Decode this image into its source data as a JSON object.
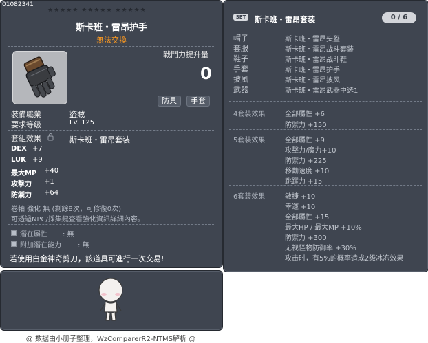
{
  "item": {
    "id": "01082341",
    "stars": "★★★★★   ★★★★★   ★★★★★",
    "name": "斯卡班・雷昂护手",
    "untradeable": "無法交換",
    "icon": "gauntlet-icon",
    "power_label": "戰鬥力提升量",
    "power_value": "0",
    "tags": [
      "防具",
      "手套"
    ],
    "job_label": "裝備職業",
    "job_value": "盜賊",
    "level_label": "要求等级",
    "level_value": "Lv. 125",
    "set_label": "套組效果",
    "set_name": "斯卡班・雷昂套装",
    "stats": [
      {
        "name": "DEX",
        "value": "+7"
      },
      {
        "name": "LUK",
        "value": "+9"
      },
      {
        "name": "最大MP",
        "value": "+40"
      },
      {
        "name": "攻擊力",
        "value": "+1"
      },
      {
        "name": "防禦力",
        "value": "+64"
      }
    ],
    "scroll_info": "卷軸 強化 無 (剩餘8次，可修復0次)",
    "npc_info": "可透過NPC/採集鍵查看強化資訊詳細內容。",
    "potential_label": "潛在屬性",
    "potential_value": ": 無",
    "bonus_potential_label": "附加潛在能力",
    "bonus_potential_value": ": 無",
    "trade_note": "若使用白金神奇剪刀，該道具可進行一次交易!"
  },
  "set": {
    "badge": "SET",
    "title": "斯卡班・雷昂套装",
    "count": "0 / 6",
    "parts": [
      {
        "slot": "帽子",
        "item": "斯卡班・雷昂头盔"
      },
      {
        "slot": "套服",
        "item": "斯卡班・雷昂战斗套装"
      },
      {
        "slot": "鞋子",
        "item": "斯卡班・雷昂战斗鞋"
      },
      {
        "slot": "手套",
        "item": "斯卡班・雷昂护手"
      },
      {
        "slot": "披風",
        "item": "斯卡班・雷昂披风"
      },
      {
        "slot": "武器",
        "item": "斯卡班・雷昂武器中选1"
      }
    ],
    "effects": [
      {
        "label": "4套装效果",
        "lines": [
          "全部屬性  +6",
          "防禦力  +150"
        ]
      },
      {
        "label": "5套装效果",
        "lines": [
          "全部屬性  +9",
          "攻擊力/魔力+10",
          "防禦力  +225",
          "移動速度  +10",
          "跳躍力  +15"
        ]
      },
      {
        "label": "6套装效果",
        "lines": [
          "敏捷  +10",
          "幸運  +10",
          "全部屬性  +15",
          "最大HP / 最大MP  +10%",
          "防禦力  +300",
          "无视怪物防御率  +30%",
          "攻击时，有5%的概率造成2级冰冻效果"
        ]
      }
    ]
  },
  "character": {
    "avatar": "character-avatar"
  },
  "footer": "@ 数据由小册子整理，WzComparerR2-NTMS解析 @"
}
